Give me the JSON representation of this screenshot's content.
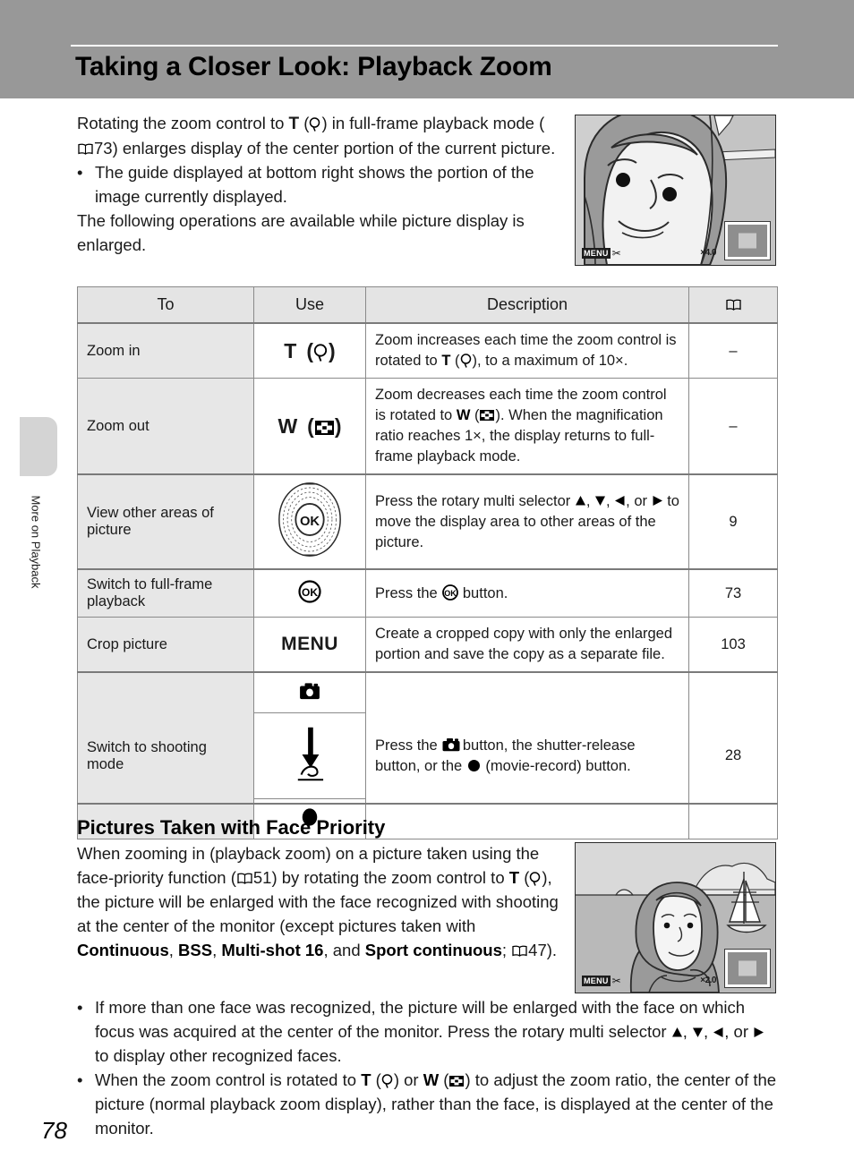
{
  "header": {
    "title": "Taking a Closer Look: Playback Zoom"
  },
  "sidebar": {
    "tab_label": "More on Playback"
  },
  "page_number": "78",
  "intro": {
    "line1_a": "Rotating the zoom control to ",
    "line1_T": "T",
    "line1_b": " (",
    "line1_c": ") in full-frame playback mode (",
    "line1_page": "73",
    "line1_d": ") enlarges display of the center portion of the current picture.",
    "bullet_dot": "•",
    "bullet1": "The guide displayed at bottom right shows the portion of the image currently displayed.",
    "closing": "The following operations are available while picture display is enlarged."
  },
  "screens": {
    "top": {
      "menu_label": "MENU",
      "scissors": "✂",
      "zoom_ratio": "×4.0"
    },
    "bottom": {
      "menu_label": "MENU",
      "scissors": "✂",
      "zoom_ratio": "×2.0"
    }
  },
  "table": {
    "headers": {
      "to": "To",
      "use": "Use",
      "description": "Description",
      "page": "book-icon"
    },
    "rows": [
      {
        "to": "Zoom in",
        "use_letter": "T",
        "use_icon": "magnifier-icon",
        "desc_a": "Zoom increases each time the zoom control is rotated to ",
        "desc_T": "T",
        "desc_b": " (",
        "desc_c": "), to a maximum of 10×.",
        "page": "–"
      },
      {
        "to": "Zoom out",
        "use_letter": "W",
        "use_icon": "wide-icon",
        "desc_a": "Zoom decreases each time the zoom control is rotated to ",
        "desc_W": "W",
        "desc_b": " (",
        "desc_c": "). When the magnification ratio reaches 1×, the display returns to full-frame playback mode.",
        "page": "–"
      },
      {
        "to": "View other areas of picture",
        "use_icon": "rotary-multi-selector-icon",
        "desc_a": "Press the rotary multi selector ",
        "desc_b": ", ",
        "desc_c": ", ",
        "desc_d": ", or ",
        "desc_e": " to move the display area to other areas of the picture.",
        "page": "9"
      },
      {
        "to": "Switch to full-frame playback",
        "use_icon": "ok-button-icon",
        "desc_a": "Press the ",
        "desc_b": " button.",
        "page": "73"
      },
      {
        "to": "Crop picture",
        "use_letter": "MENU",
        "desc_a": "Create a cropped copy with only the enlarged portion and save the copy as a separate file.",
        "page": "103"
      },
      {
        "to": "Switch to shooting mode",
        "use_icons": [
          "camera-icon",
          "shutter-release-icon",
          "movie-record-icon"
        ],
        "desc_a": "Press the ",
        "desc_b": " button, the shutter-release button, or the ",
        "desc_c": " (movie-record) button.",
        "page": "28"
      }
    ]
  },
  "face_priority": {
    "title": "Pictures Taken with Face Priority",
    "body_a": "When zooming in (playback zoom) on a picture taken using the face-priority function (",
    "body_page1": "51",
    "body_b": ") by rotating the zoom control to ",
    "body_T": "T",
    "body_c": " (",
    "body_d": "), the picture will be enlarged with the face recognized with shooting at the center of the monitor (except pictures taken with ",
    "bold1": "Continuous",
    "body_e": ", ",
    "bold2": "BSS",
    "body_f": ", ",
    "bold3": "Multi-shot 16",
    "body_g": ", and ",
    "bold4": "Sport continuous",
    "body_h": "; ",
    "body_page2": "47",
    "body_i": ").",
    "bullet_dot": "•",
    "bullet1_a": "If more than one face was recognized, the picture will be enlarged with the face on which focus was acquired at the center of the monitor. Press the rotary multi selector ",
    "bullet1_b": ", ",
    "bullet1_c": ", ",
    "bullet1_d": ", or ",
    "bullet1_e": " to display other recognized faces.",
    "bullet2_a": "When the zoom control is rotated to ",
    "bullet2_T": "T",
    "bullet2_b": " (",
    "bullet2_c": ") or ",
    "bullet2_W": "W",
    "bullet2_d": " (",
    "bullet2_e": ") to adjust the zoom ratio, the center of the picture (normal playback zoom display), rather than the face, is displayed at the center of the monitor."
  },
  "colors": {
    "header_band": "#989898",
    "table_header_bg": "#e4e4e4",
    "table_left_col_bg": "#e7e7e7",
    "side_tab": "#d4d4d4"
  }
}
